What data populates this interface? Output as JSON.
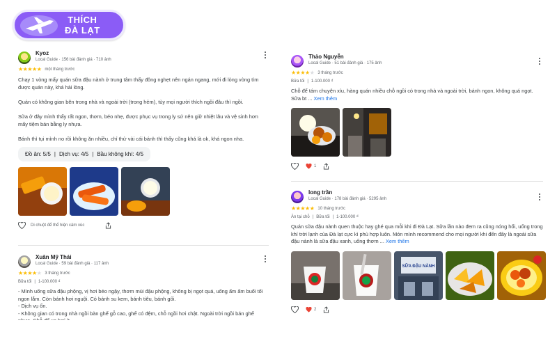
{
  "brand": {
    "line1": "THÍCH",
    "line2": "ĐÀ LẠT"
  },
  "reviews": {
    "kyoz": {
      "name": "Kyoz",
      "sub": "Local Guide · 156 bài đánh giá · 710 ảnh",
      "stars": 5,
      "when": "một tháng trước",
      "p1": "Chạy 1 vòng mấy quán sữa đậu nành ở trung tâm thấy đông nghẹt nên ngán ngang, mới đi lòng vòng tìm được quán này, khá hài lòng.",
      "p2": "Quán có không gian bên trong nhà và ngoài trời (trong hẻm), tùy mọi người thích ngồi đâu thì ngồi.",
      "p3": "Sữa ở đây mình thấy rất ngon, thơm, béo nhẹ, được phục vụ trong ly sứ nên giữ nhiệt lâu và vệ sinh hơn mấy tiệm bán bằng ly nhựa.",
      "p4": "Bánh thì tụi mình no rồi không ăn nhiều, chỉ thử vài cái bánh thì thấy cũng khá là ok, khá ngon nha.",
      "tags": [
        "Đồ ăn: 5/5",
        "|",
        "Dịch vụ: 4/5",
        "|",
        "Bầu không khí: 4/5"
      ],
      "hover_hint": "Di chuột để thể hiện cảm xúc"
    },
    "xuan": {
      "name": "Xuân Mỹ Thái",
      "sub": "Local Guide · 59 bài đánh giá · 117 ảnh",
      "stars": 4,
      "when": "3 tháng trước",
      "meta": [
        "Bữa tối",
        "|",
        "1-100.000 ₫"
      ],
      "l1": "- Mình uống sữa đậu phộng, vị hơi béo ngậy, thơm mùi đậu phộng, không bị ngọt quá, uống ấm ấm buổi tối ngon lắm. Còn bánh hơi nguội. Có bánh su kem, bánh tiêu, bánh gối.",
      "l2": "- Dịch vụ ổn.",
      "l3": "- Không gian có trong nhà ngồi bàn ghế gỗ cao, ghế có đệm, chỗ ngồi hơi chật. Ngoài trời ngồi bán ghế nhựa. Chỗ để xe hơi ít."
    },
    "thao": {
      "name": "Thảo Nguyễn",
      "sub": "Local Guide · 51 bài đánh giá · 175 ảnh",
      "stars": 4,
      "when": "3 tháng trước",
      "meta": [
        "Bữa tối",
        "|",
        "1-100.000 ₫"
      ],
      "text": "Chỗ để tám chuyện xíu, hàng quán nhiều chỗ ngồi có trong nhà và ngoài trời, bánh ngon, không quá ngọt. Sữa bt ...",
      "more": "Xem thêm",
      "likes": "1"
    },
    "long": {
      "name": "long trần",
      "sub": "Local Guide · 178 bài đánh giá · 5295 ảnh",
      "stars": 5,
      "when": "10 tháng trước",
      "meta": [
        "Ăn tại chỗ",
        "|",
        "Bữa tối",
        "|",
        "1-100.000 ₫"
      ],
      "text": "Quán sữa đậu nành quen thuộc hay ghé qua mỗi khi đi Đà Lạt. Sữa lần nào đem ra cũng nóng hổi, uống trong khí trời lạnh của Đà lạt cực kì phù hợp luôn. Món mình recommend cho mọi người khi đến đây là ngoài sữa đậu nành là sữa đậu xanh, uống thơm ...",
      "more": "Xem thêm",
      "likes": "2",
      "sign": "SỮA ĐẬU NÀNH"
    }
  },
  "colors": {
    "accent": "#8b5cf6",
    "star": "#fbbc04",
    "link": "#1a73e8",
    "heart": "#ea4335"
  }
}
